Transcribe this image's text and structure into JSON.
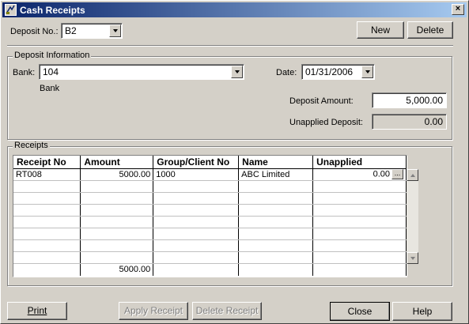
{
  "window": {
    "title": "Cash Receipts",
    "close_glyph": "×"
  },
  "deposit": {
    "label": "Deposit No.:",
    "value": "B2"
  },
  "toolbar": {
    "new_label": "New",
    "delete_label": "Delete"
  },
  "deposit_info": {
    "legend": "Deposit Information",
    "bank_label": "Bank:",
    "bank_value": "104",
    "bank_name": "Bank",
    "date_label": "Date:",
    "date_value": "01/31/2006",
    "amount_label": "Deposit Amount:",
    "amount_value": "5,000.00",
    "unapplied_label": "Unapplied Deposit:",
    "unapplied_value": "0.00"
  },
  "receipts": {
    "legend": "Receipts",
    "columns": [
      "Receipt No",
      "Amount",
      "Group/Client No",
      "Name",
      "Unapplied"
    ],
    "rows": [
      {
        "receipt_no": "RT008",
        "amount": "5000.00",
        "group_client": "1000",
        "name": "ABC Limited",
        "unapplied": "0.00"
      }
    ],
    "ellipsis": "...",
    "total_amount": "5000.00"
  },
  "footer": {
    "print_label": "Print",
    "apply_label": "Apply Receipt",
    "delete_receipt_label": "Delete Receipt",
    "close_label": "Close",
    "help_label": "Help"
  },
  "icons": {
    "app": "cash-receipts-app-icon",
    "close": "close-icon",
    "dropdown": "chevron-down-icon"
  }
}
